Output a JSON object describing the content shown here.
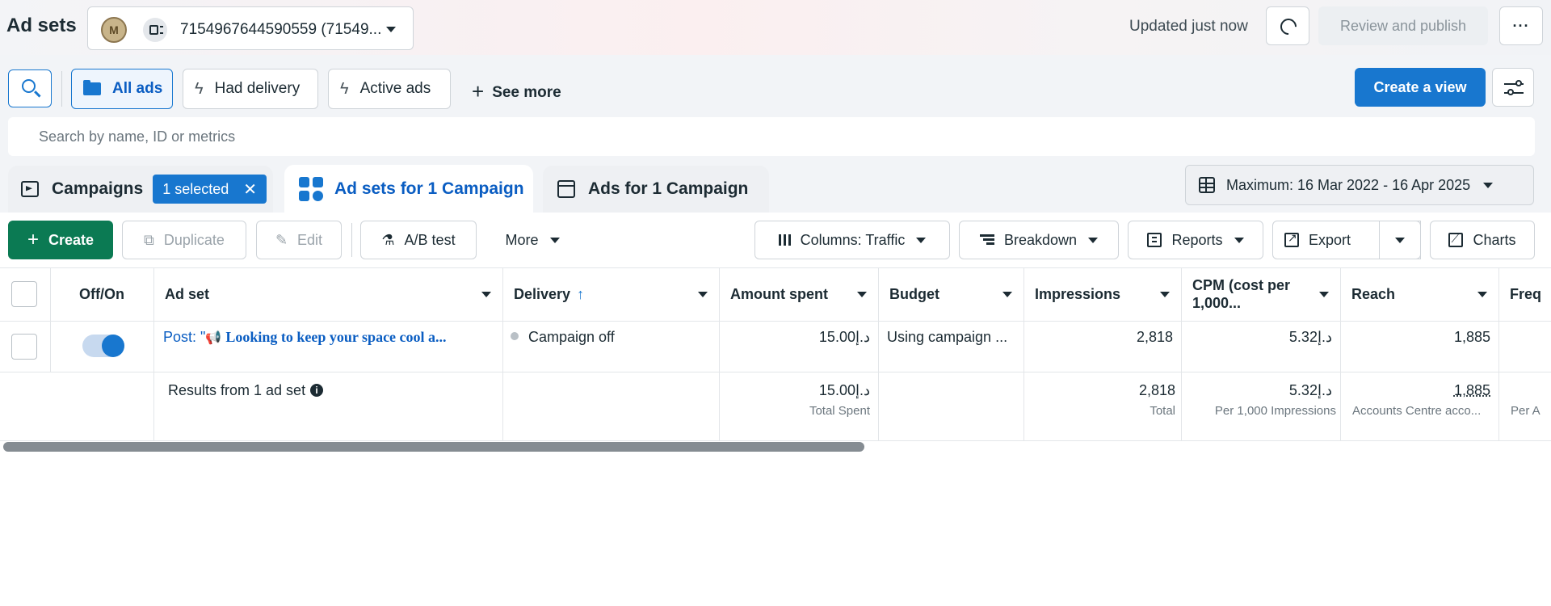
{
  "header": {
    "title": "Ad sets",
    "account_text": "7154967644590559 (71549...",
    "account_logo_letter": "M",
    "updated": "Updated just now",
    "review_publish": "Review and publish",
    "more_dots": "···"
  },
  "filters": {
    "chips": [
      "All ads",
      "Had delivery",
      "Active ads"
    ],
    "see_more": "See more",
    "create_view": "Create a view",
    "search_placeholder": "Search by name, ID or metrics"
  },
  "tabs": {
    "campaigns": "Campaigns",
    "selected": "1 selected",
    "adsets": "Ad sets for 1 Campaign",
    "ads": "Ads for 1 Campaign",
    "date_range": "Maximum: 16 Mar 2022 - 16 Apr 2025"
  },
  "toolbar": {
    "create": "Create",
    "duplicate": "Duplicate",
    "edit": "Edit",
    "ab_test": "A/B test",
    "more": "More",
    "columns": "Columns: Traffic",
    "breakdown": "Breakdown",
    "reports": "Reports",
    "export": "Export",
    "charts": "Charts"
  },
  "table": {
    "headers": {
      "off_on": "Off/On",
      "ad_set": "Ad set",
      "delivery": "Delivery",
      "amount_spent": "Amount spent",
      "budget": "Budget",
      "impressions": "Impressions",
      "cpm_line1": "CPM (cost per",
      "cpm_line2": "1,000...",
      "reach": "Reach",
      "frequency": "Freq"
    },
    "row": {
      "ad_set_prefix": "Post: \"",
      "ad_set_name": "Looking to keep your space cool a...",
      "delivery": "Campaign off",
      "amount_spent": "15.00د.إ",
      "budget": "Using campaign ...",
      "impressions": "2,818",
      "cpm": "5.32د.إ",
      "reach": "1,885",
      "toggle_on": true
    },
    "summary": {
      "label": "Results from 1 ad set",
      "amount_spent": "15.00د.إ",
      "amount_spent_sub": "Total Spent",
      "impressions": "2,818",
      "impressions_sub": "Total",
      "cpm": "5.32د.إ",
      "cpm_sub": "Per 1,000 Impressions",
      "reach": "1,885",
      "reach_sub": "Accounts Centre acco...",
      "frequency_sub": "Per A"
    }
  },
  "colors": {
    "accent": "#1877cf",
    "create_green": "#0b7a53"
  }
}
